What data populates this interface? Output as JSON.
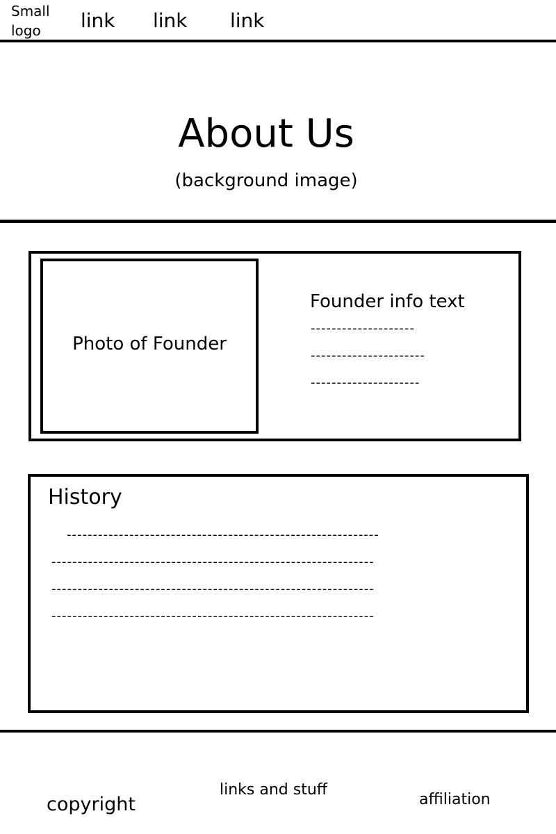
{
  "header": {
    "logo_text": "Small\nlogo",
    "nav_links": [
      "link",
      "link",
      "link"
    ]
  },
  "hero": {
    "title": "About Us",
    "subtitle": "(background image)"
  },
  "founder": {
    "photo_label": "Photo of Founder",
    "info_title": "Founder info text",
    "info_lines": [
      "--------------------",
      "----------------------",
      "---------------------"
    ]
  },
  "history": {
    "title": "History",
    "lines": [
      "------------------------------------------------------------",
      "--------------------------------------------------------------",
      "--------------------------------------------------------------",
      "--------------------------------------------------------------"
    ]
  },
  "footer": {
    "copyright": "copyright",
    "links": "links and stuff",
    "affiliation": "affiliation"
  }
}
